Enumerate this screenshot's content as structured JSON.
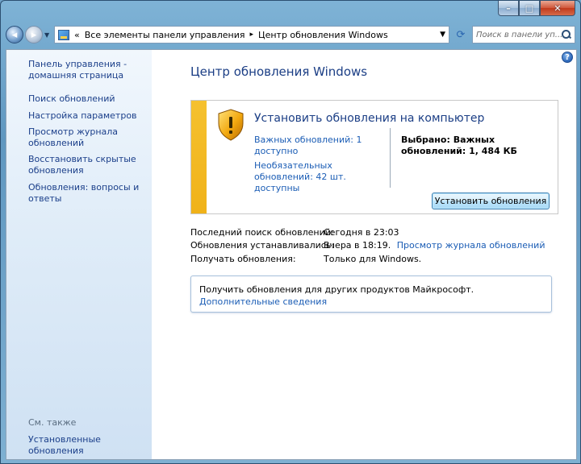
{
  "window": {
    "minimize": "–",
    "maximize": "□",
    "close": "✕"
  },
  "address_bar": {
    "prefix": "«",
    "crumbs": [
      "Все элементы панели управления",
      "Центр обновления Windows"
    ],
    "separator": "▸"
  },
  "search": {
    "placeholder": "Поиск в панели уп..."
  },
  "sidebar": {
    "home_link": "Панель управления - домашняя страница",
    "links": [
      "Поиск обновлений",
      "Настройка параметров",
      "Просмотр журнала обновлений",
      "Восстановить скрытые обновления",
      "Обновления: вопросы и ответы"
    ],
    "see_also_label": "См. также",
    "see_also_link": "Установленные обновления"
  },
  "main": {
    "title": "Центр обновления Windows",
    "update_box": {
      "heading": "Установить обновления на компьютер",
      "important_link": "Важных обновлений: 1 доступно",
      "optional_link": "Необязательных обновлений: 42 шт. доступны",
      "selected_text": "Выбрано: Важных обновлений: 1, 484 КБ",
      "install_button": "Установить обновления"
    },
    "info": {
      "last_search_label": "Последний поиск обновлений:",
      "last_search_value": "Сегодня в 23:03",
      "installed_label": "Обновления устанавливались:",
      "installed_value": "Вчера в 18:19.",
      "history_link": "Просмотр журнала обновлений",
      "receive_label": "Получать обновления:",
      "receive_value": "Только для Windows."
    },
    "other_products": {
      "text": "Получить обновления для других продуктов Майкрософт.",
      "link": "Дополнительные сведения"
    }
  },
  "colors": {
    "link": "#1b5db5",
    "title": "#1b3e85",
    "warning_bar": "#f0b219"
  }
}
